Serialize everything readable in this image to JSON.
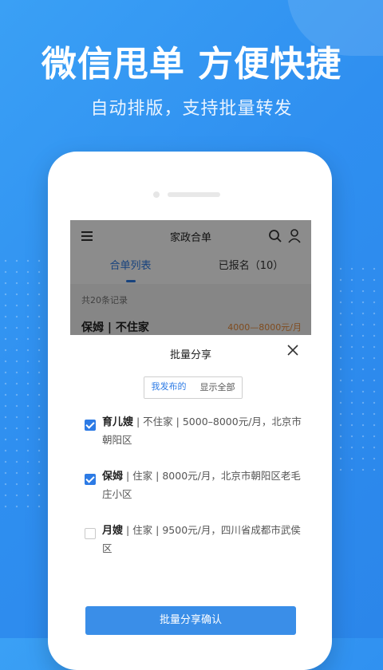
{
  "headline": "微信甩单 方便快捷",
  "subline": "自动排版，支持批量转发",
  "app": {
    "title": "家政合单",
    "tabs": [
      {
        "label": "合单列表",
        "active": true
      },
      {
        "label": "已报名（10）",
        "active": false
      }
    ],
    "count_text": "共20条记录",
    "peek_item": "保姆 | 不住家",
    "peek_price": "4000—8000元/月"
  },
  "sheet": {
    "title": "批量分享",
    "segments": [
      {
        "label": "我发布的",
        "active": true
      },
      {
        "label": "显示全部",
        "active": false
      }
    ],
    "items": [
      {
        "name": "育儿嫂",
        "detail": " | 不住家 | 5000–8000元/月，北京市朝阳区",
        "checked": true
      },
      {
        "name": "保姆",
        "detail": " | 住家 | 8000元/月，北京市朝阳区老毛庄小区",
        "checked": true
      },
      {
        "name": "月嫂",
        "detail": " | 住家 | 9500元/月，四川省成都市武侯区",
        "checked": false
      }
    ],
    "confirm_label": "批量分享确认"
  },
  "icons": [
    "menu-icon",
    "search-icon",
    "user-icon",
    "close-icon",
    "check-icon"
  ],
  "colors": {
    "accent": "#2d7be5",
    "background": "#2f8ff0",
    "button": "#3a8ee8"
  }
}
